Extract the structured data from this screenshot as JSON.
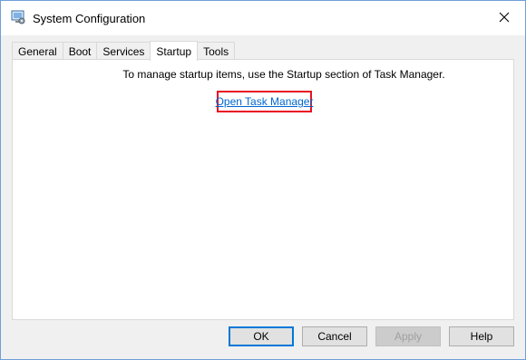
{
  "window": {
    "title": "System Configuration",
    "icon": "computer-settings-icon",
    "close_icon": "close-icon"
  },
  "tabs": [
    {
      "label": "General",
      "active": false
    },
    {
      "label": "Boot",
      "active": false
    },
    {
      "label": "Services",
      "active": false
    },
    {
      "label": "Startup",
      "active": true
    },
    {
      "label": "Tools",
      "active": false
    }
  ],
  "startup_tab": {
    "info_text": "To manage startup items, use the Startup section of Task Manager.",
    "link_text": "Open Task Manager",
    "highlight_color": "#e81123",
    "link_color": "#0066cc"
  },
  "buttons": {
    "ok": "OK",
    "cancel": "Cancel",
    "apply": "Apply",
    "help": "Help"
  }
}
